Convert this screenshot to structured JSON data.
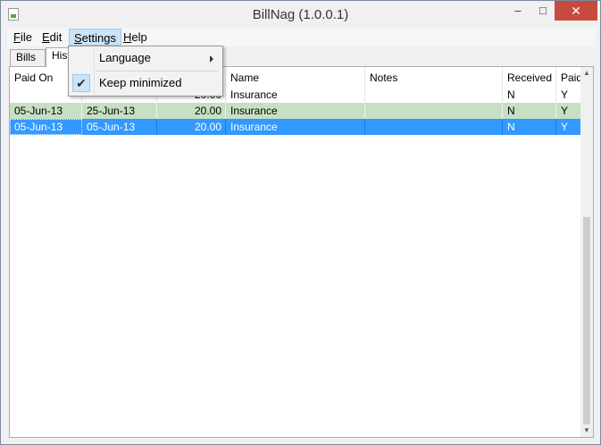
{
  "window": {
    "title": "BillNag (1.0.0.1)",
    "icon": "app-icon",
    "min_glyph": "–",
    "max_glyph": "□",
    "close_glyph": "✕"
  },
  "menubar": {
    "file": {
      "mnemonic": "F",
      "rest": "ile"
    },
    "edit": {
      "mnemonic": "E",
      "rest": "dit"
    },
    "settings": {
      "mnemonic": "S",
      "rest": "ettings"
    },
    "help": {
      "mnemonic": "H",
      "rest": "elp"
    }
  },
  "tabs": {
    "bills": "Bills",
    "history": "Hist"
  },
  "settings_menu": {
    "language": "Language",
    "keep_minimized": "Keep minimized",
    "keep_minimized_checked": true,
    "check_glyph": "✔"
  },
  "table": {
    "columns": [
      "Paid On",
      "",
      "",
      "Name",
      "Notes",
      "Received",
      "Paid"
    ],
    "rows": [
      {
        "paid_on": "",
        "due": "",
        "amount": "20.00",
        "name": "Insurance",
        "notes": "",
        "received": "N",
        "paid": "Y",
        "style": "normal"
      },
      {
        "paid_on": "05-Jun-13",
        "due": "25-Jun-13",
        "amount": "20.00",
        "name": "Insurance",
        "notes": "",
        "received": "N",
        "paid": "Y",
        "style": "alt"
      },
      {
        "paid_on": "05-Jun-13",
        "due": "05-Jun-13",
        "amount": "20.00",
        "name": "Insurance",
        "notes": "",
        "received": "N",
        "paid": "Y",
        "style": "selected"
      }
    ]
  },
  "colors": {
    "close_button": "#c74a3e",
    "row_alt": "#c7e0c3",
    "row_selected": "#3399ff",
    "menu_highlight": "#cce4f7"
  },
  "scrollbar": {
    "up_glyph": "▲",
    "down_glyph": "▼"
  }
}
